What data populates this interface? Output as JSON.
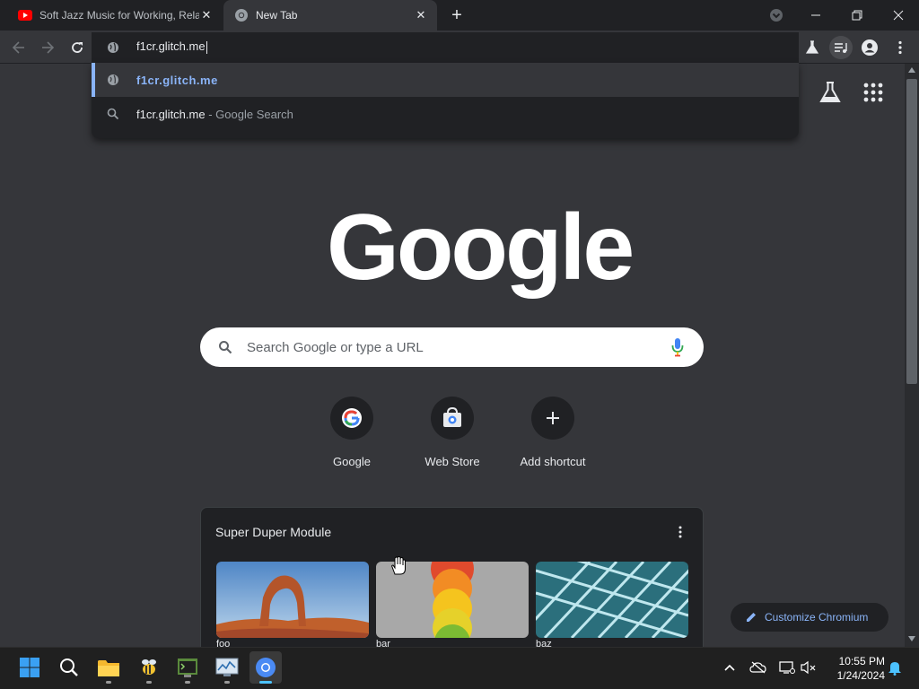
{
  "tabs": [
    {
      "title": "Soft Jazz Music for Working, Relax",
      "favicon": "youtube-icon"
    },
    {
      "title": "New Tab",
      "favicon": "chromium-icon"
    }
  ],
  "omnibox": {
    "value": "f1cr.glitch.me",
    "suggestions": [
      {
        "text": "f1cr.glitch.me",
        "icon": "globe-icon"
      },
      {
        "text": "f1cr.glitch.me",
        "suffix": "- Google Search",
        "icon": "search-icon"
      }
    ]
  },
  "ntp": {
    "logo": "Google",
    "search_placeholder": "Search Google or type a URL",
    "shortcuts": [
      {
        "label": "Google"
      },
      {
        "label": "Web Store"
      },
      {
        "label": "Add shortcut"
      }
    ],
    "module": {
      "title": "Super Duper Module",
      "items": [
        "foo",
        "bar",
        "baz"
      ]
    },
    "customize_label": "Customize Chromium"
  },
  "taskbar": {
    "time": "10:55 PM",
    "date": "1/24/2024"
  },
  "colors": {
    "accent": "#8ab4f8",
    "frame": "#202124",
    "toolbar": "#35363a",
    "youtube_red": "#ff0000"
  }
}
